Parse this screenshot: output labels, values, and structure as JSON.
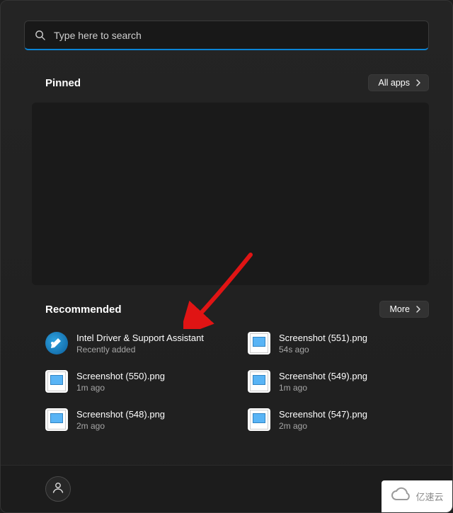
{
  "search": {
    "placeholder": "Type here to search"
  },
  "pinned": {
    "title": "Pinned",
    "all_apps_label": "All apps"
  },
  "recommended": {
    "title": "Recommended",
    "more_label": "More",
    "items": [
      {
        "title": "Intel Driver & Support Assistant",
        "subtitle": "Recently added",
        "icon": "app"
      },
      {
        "title": "Screenshot (551).png",
        "subtitle": "54s ago",
        "icon": "file"
      },
      {
        "title": "Screenshot (550).png",
        "subtitle": "1m ago",
        "icon": "file"
      },
      {
        "title": "Screenshot (549).png",
        "subtitle": "1m ago",
        "icon": "file"
      },
      {
        "title": "Screenshot (548).png",
        "subtitle": "2m ago",
        "icon": "file"
      },
      {
        "title": "Screenshot (547).png",
        "subtitle": "2m ago",
        "icon": "file"
      }
    ]
  },
  "watermark": {
    "text": "亿速云"
  },
  "annotation": {
    "arrow_color": "#e01414"
  }
}
